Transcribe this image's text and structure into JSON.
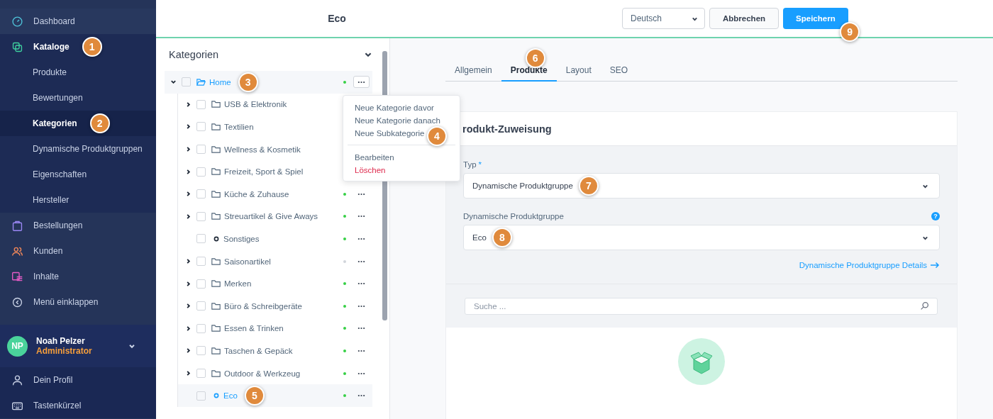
{
  "sidebar": {
    "items": [
      {
        "label": "Dashboard"
      },
      {
        "label": "Kataloge",
        "selected": true,
        "marker": "1",
        "children": [
          {
            "label": "Produkte",
            "selected": false
          },
          {
            "label": "Bewertungen",
            "selected": false
          },
          {
            "label": "Kategorien",
            "selected": true,
            "marker": "2"
          },
          {
            "label": "Dynamische Produktgruppen",
            "selected": false
          },
          {
            "label": "Eigenschaften",
            "selected": false
          },
          {
            "label": "Hersteller",
            "selected": false
          }
        ]
      },
      {
        "label": "Bestellungen"
      },
      {
        "label": "Kunden"
      },
      {
        "label": "Inhalte"
      },
      {
        "label": "Menü einklappen"
      }
    ],
    "user": {
      "initials": "NP",
      "name": "Noah Pelzer",
      "role": "Administrator"
    },
    "footer": [
      {
        "label": "Dein Profil"
      },
      {
        "label": "Tastenkürzel"
      }
    ]
  },
  "header": {
    "title": "Eco",
    "language": "Deutsch",
    "cancel": "Abbrechen",
    "save": "Speichern",
    "save_marker": "9"
  },
  "tree": {
    "title": "Kategorien",
    "nodes": [
      {
        "label": "Home",
        "kind": "root",
        "expanded": true,
        "checked": false,
        "selected": true,
        "active": true,
        "menu_open": true,
        "marker": "3",
        "children": [
          {
            "label": "USB & Elektronik",
            "kind": "folder",
            "expanded": false,
            "checked": false,
            "selected": false
          },
          {
            "label": "Textilien",
            "kind": "folder",
            "expanded": false,
            "checked": false,
            "selected": false
          },
          {
            "label": "Wellness & Kosmetik",
            "kind": "folder",
            "expanded": false,
            "checked": false,
            "selected": false
          },
          {
            "label": "Freizeit, Sport & Spiel",
            "kind": "folder",
            "expanded": false,
            "checked": false,
            "selected": false
          },
          {
            "label": "Küche & Zuhause",
            "kind": "folder",
            "expanded": false,
            "checked": false,
            "selected": false,
            "active": true
          },
          {
            "label": "Streuartikel & Give Aways",
            "kind": "folder",
            "expanded": false,
            "checked": false,
            "selected": false,
            "active": true
          },
          {
            "label": "Sonstiges",
            "kind": "leaf",
            "checked": false,
            "selected": false,
            "active": true
          },
          {
            "label": "Saisonartikel",
            "kind": "folder",
            "expanded": false,
            "checked": false,
            "selected": false,
            "active": false
          },
          {
            "label": "Merken",
            "kind": "folder",
            "expanded": false,
            "checked": false,
            "selected": false,
            "active": true
          },
          {
            "label": "Büro & Schreibgeräte",
            "kind": "folder",
            "expanded": false,
            "checked": false,
            "selected": false,
            "active": true
          },
          {
            "label": "Essen & Trinken",
            "kind": "folder",
            "expanded": false,
            "checked": false,
            "selected": false,
            "active": true
          },
          {
            "label": "Taschen & Gepäck",
            "kind": "folder",
            "expanded": false,
            "checked": false,
            "selected": false,
            "active": true
          },
          {
            "label": "Outdoor & Werkzeug",
            "kind": "folder",
            "expanded": false,
            "checked": false,
            "selected": false,
            "active": true
          },
          {
            "label": "Eco",
            "kind": "leaf",
            "checked": false,
            "selected": true,
            "active": true,
            "marker": "5"
          }
        ]
      }
    ]
  },
  "context_menu": {
    "groups": [
      [
        {
          "label": "Neue Kategorie davor",
          "kind": "normal"
        },
        {
          "label": "Neue Kategorie danach",
          "kind": "normal"
        },
        {
          "label": "Neue Subkategorie",
          "kind": "normal",
          "marker": "4"
        }
      ],
      [
        {
          "label": "Bearbeiten",
          "kind": "normal"
        },
        {
          "label": "Löschen",
          "kind": "danger"
        }
      ]
    ]
  },
  "tabs": [
    {
      "label": "Allgemein",
      "selected": false
    },
    {
      "label": "Produkte",
      "selected": true,
      "marker": "6"
    },
    {
      "label": "Layout",
      "selected": false
    },
    {
      "label": "SEO",
      "selected": false
    }
  ],
  "card": {
    "title": "rodukt-Zuweisung",
    "fields": [
      {
        "label": "Typ",
        "required": "*",
        "value": "Dynamische Produktgruppe",
        "marker": "7"
      },
      {
        "label": "Dynamische Produktgruppe",
        "help": "?",
        "value": "Eco",
        "marker": "8"
      }
    ],
    "link": "Dynamische Produktgruppe Details",
    "search": {
      "placeholder": "Suche ..."
    }
  }
}
